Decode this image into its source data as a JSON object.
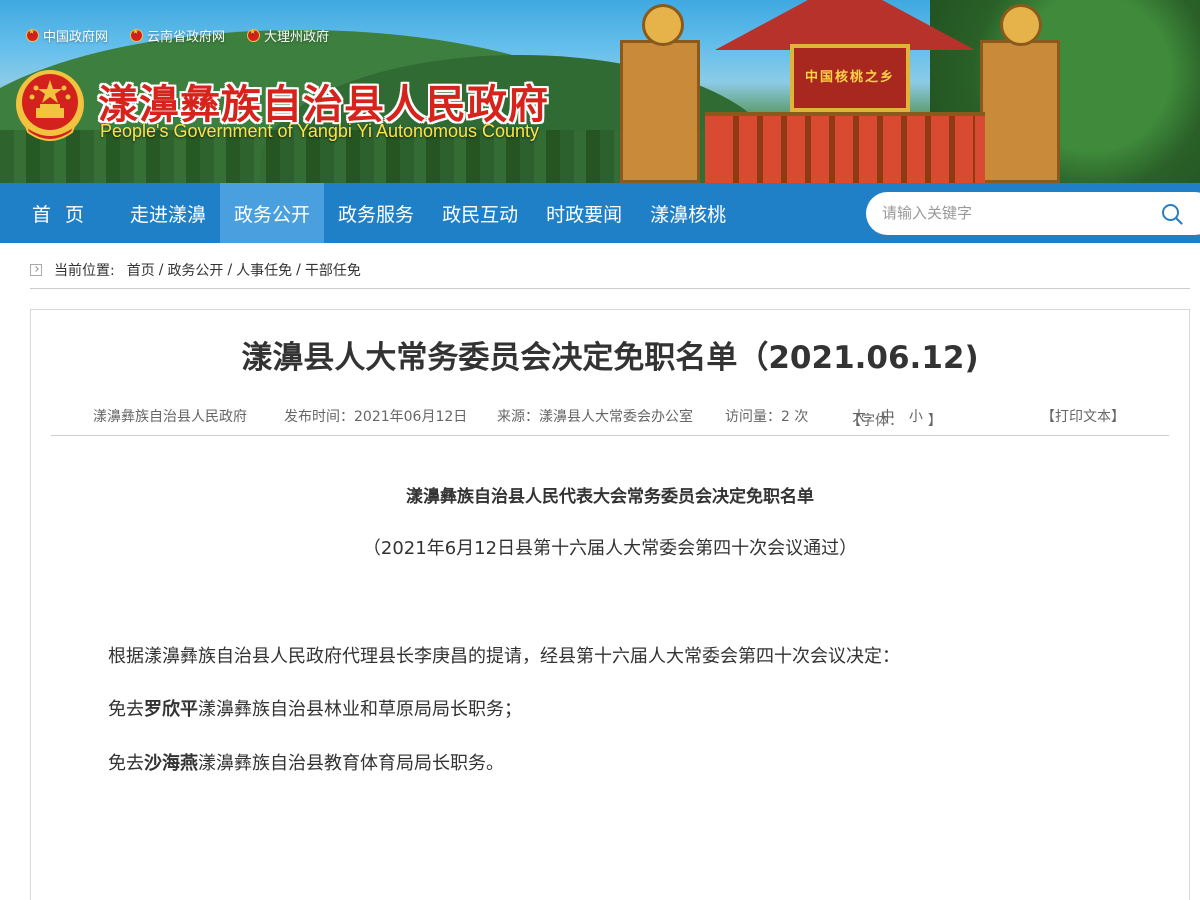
{
  "top_links": [
    "中国政府网",
    "云南省政府网",
    "大理州政府"
  ],
  "site": {
    "title": "漾濞彝族自治县人民政府",
    "subtitle": "People's Government of Yangbi Yi Autonomous County",
    "gate_sign": "中国核桃之乡"
  },
  "nav": {
    "items": [
      "首页",
      "走进漾濞",
      "政务公开",
      "政务服务",
      "政民互动",
      "时政要闻",
      "漾濞核桃"
    ],
    "active": "政务公开"
  },
  "search": {
    "placeholder": "请输入关键字"
  },
  "breadcrumb": {
    "label": "当前位置:",
    "items": [
      "首页",
      "政务公开",
      "人事任免",
      "干部任免"
    ]
  },
  "article": {
    "title": "漾濞县人大常务委员会决定免职名单（2021.06.12)",
    "meta": {
      "site": "漾濞彝族自治县人民政府",
      "date": "发布时间：2021年06月12日",
      "source": "来源：漾濞县人大常委会办公室",
      "views": "访问量：2 次",
      "font_label": "【字体：",
      "font_large": "大",
      "font_medium": "中",
      "font_small": "小",
      "font_close": "】",
      "print": "【打印文本】"
    },
    "heading": "漾濞彝族自治县人民代表大会常务委员会决定免职名单",
    "sub": "（2021年6月12日县第十六届人大常委会第四十次会议通过）",
    "para1": "根据漾濞彝族自治县人民政府代理县长李庚昌的提请，经县第十六届人大常委会第四十次会议决定：",
    "para2_prefix": "免去",
    "para2_name": "罗欣平",
    "para2_suffix": "漾濞彝族自治县林业和草原局局长职务；",
    "para3_prefix": "免去",
    "para3_name": "沙海燕",
    "para3_suffix": "漾濞彝族自治县教育体育局局长职务。"
  },
  "colors": {
    "nav": "#1f80c8",
    "nav_active": "#4a9fde",
    "title_red": "#d6231c",
    "subtitle_yellow": "#ffe24a"
  }
}
